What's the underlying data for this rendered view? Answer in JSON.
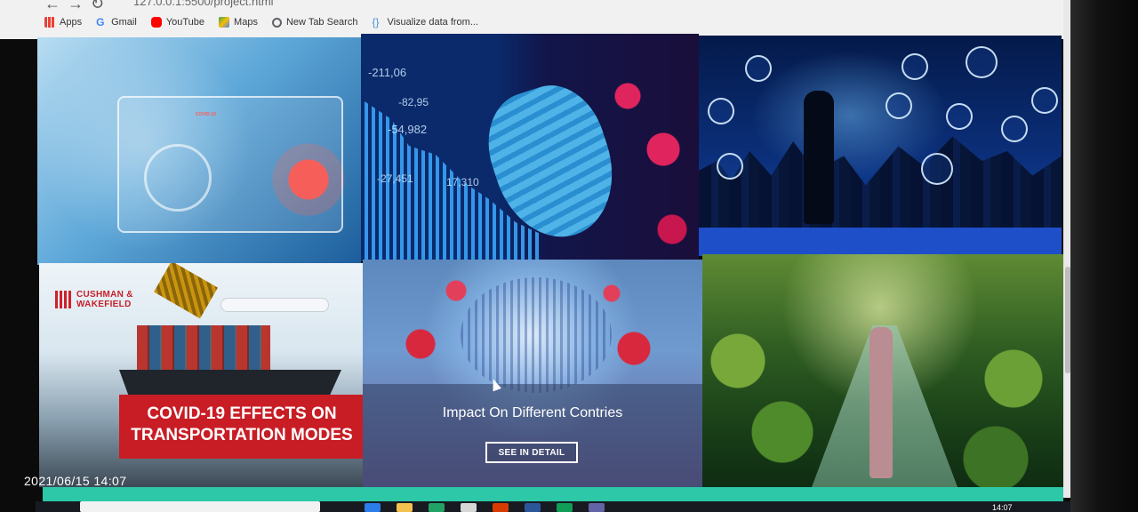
{
  "browser": {
    "url": "127.0.0.1:5500/project.html",
    "bookmarks": [
      {
        "label": "Apps",
        "icon": "apps-grid-icon",
        "color": "#e94235"
      },
      {
        "label": "Gmail",
        "icon": "google-icon",
        "color": "#4285f4"
      },
      {
        "label": "YouTube",
        "icon": "youtube-icon",
        "color": "#ff0000"
      },
      {
        "label": "Maps",
        "icon": "maps-icon",
        "color": "#34a853"
      },
      {
        "label": "New Tab Search",
        "icon": "search-icon",
        "color": "#5f6368"
      },
      {
        "label": "Visualize data from...",
        "icon": "code-brackets-icon",
        "color": "#4a90d9"
      }
    ]
  },
  "tiles": {
    "tile1": {
      "chip_label": "COVID-19"
    },
    "tile2": {
      "numbers": [
        "-211,06",
        "-82,95",
        "-54,982",
        "-27,451",
        "17,310"
      ]
    },
    "tile4": {
      "logo_line1": "CUSHMAN &",
      "logo_line2": "WAKEFIELD",
      "banner_line1": "COVID-19 EFFECTS ON",
      "banner_line2": "TRANSPORTATION MODES"
    },
    "tile5": {
      "caption": "Impact On Different Contries",
      "button_label": "SEE IN DETAIL"
    }
  },
  "overlay": {
    "timestamp": "2021/06/15 14:07",
    "clock": "14:07"
  },
  "colors": {
    "banner_red": "#c81d25",
    "bottom_strip": "#2cc8a8"
  }
}
